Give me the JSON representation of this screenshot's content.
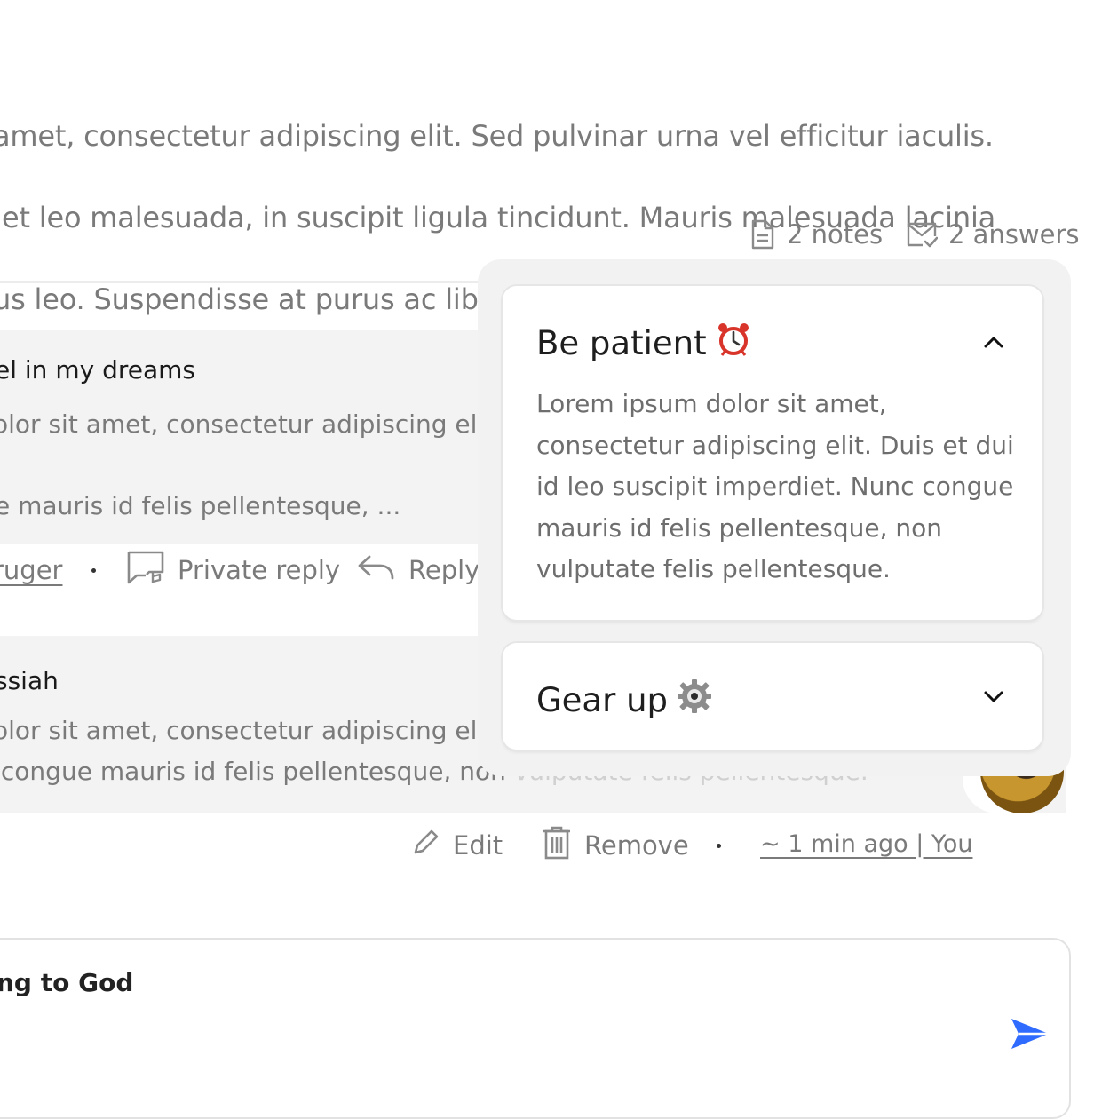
{
  "intro": {
    "lines": [
      "amet, consectetur adipiscing elit. Sed pulvinar urna vel efficitur iaculis.",
      " et leo malesuada, in suscipit ligula tincidunt. Mauris malesuada lacinia",
      "us leo. Suspendisse at purus ac libero volutpat consequat."
    ]
  },
  "meta": {
    "notes": "2 notes",
    "answers": "2 answers"
  },
  "comment1": {
    "title": "el in my dreams",
    "line1": "olor sit amet, consectetur adipiscing elit.",
    "line2": "e mauris id felis pellentesque, ...",
    "author": "ruger",
    "private_reply": "Private reply",
    "reply": "Reply"
  },
  "comment2": {
    "title": "ssiah",
    "line1": "olor sit amet, consectetur adipiscing elit.",
    "line2": " congue mauris id felis pellentesque, non",
    "line2_hidden": "vulputate felis pellentesque."
  },
  "own_actions": {
    "edit": "Edit",
    "remove": "Remove",
    "timestamp": "~ 1 min ago | You"
  },
  "popup": {
    "cards": [
      {
        "title": "Be patient",
        "emoji": "⏰",
        "expanded": true,
        "body": "Lorem ipsum dolor sit amet, consectetur adipiscing elit. Duis et dui id leo suscipit imperdiet. Nunc congue mauris id felis pellentesque, non vulputate felis pellentesque."
      },
      {
        "title": "Gear up",
        "emoji": "⚙️",
        "expanded": false
      }
    ]
  },
  "reply_box": {
    "value": "ng to God"
  },
  "colors": {
    "send": "#2f6bff",
    "popup_bg": "#f2f2f2",
    "comment_bg": "#f3f3f3"
  }
}
